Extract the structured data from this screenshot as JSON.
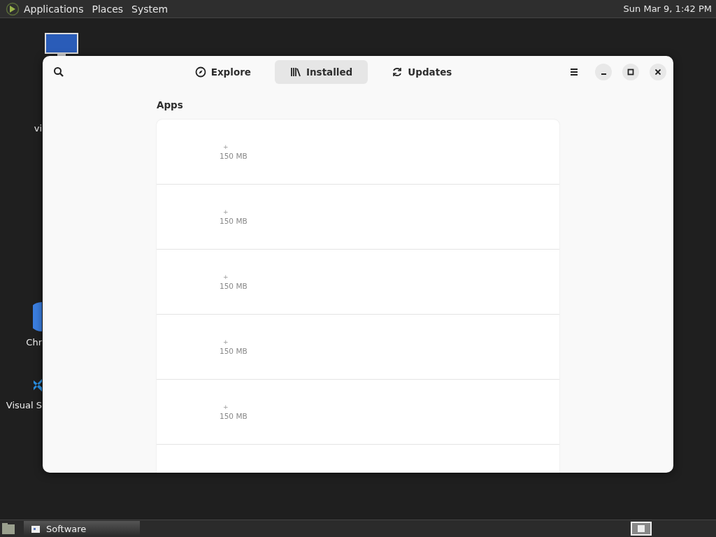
{
  "top_panel": {
    "menus": [
      "Applications",
      "Places",
      "System"
    ],
    "clock": "Sun Mar 9, 1:42 PM"
  },
  "desktop_icons": [
    {
      "kind": "monitor"
    },
    {
      "kind": "none",
      "label": "vi"
    },
    {
      "kind": "chrome",
      "label": "Chr"
    },
    {
      "kind": "vscode",
      "label": "Visual S"
    }
  ],
  "window": {
    "tabs": [
      {
        "label": "Explore",
        "kind": "explore",
        "selected": false
      },
      {
        "label": "Installed",
        "kind": "installed",
        "selected": true
      },
      {
        "label": "Updates",
        "kind": "updates",
        "selected": false
      }
    ],
    "section_title": "Apps",
    "apps": [
      {
        "mark": "+",
        "size": "150 MB"
      },
      {
        "mark": "+",
        "size": "150 MB"
      },
      {
        "mark": "+",
        "size": "150 MB"
      },
      {
        "mark": "+",
        "size": "150 MB"
      },
      {
        "mark": "+",
        "size": "150 MB"
      }
    ]
  },
  "taskbar": {
    "tasks": [
      {
        "label": "Software",
        "selected": true
      }
    ]
  }
}
